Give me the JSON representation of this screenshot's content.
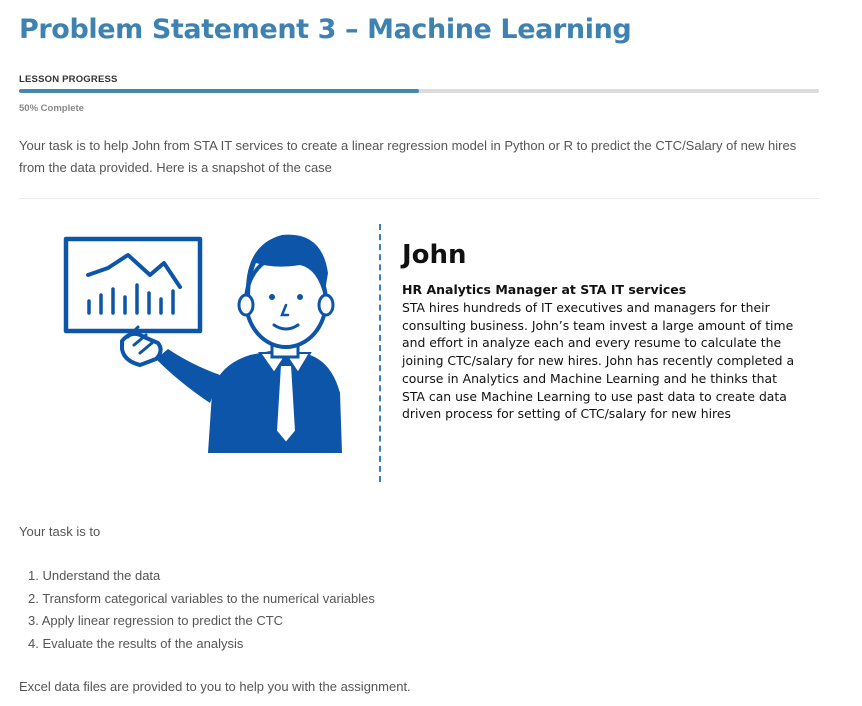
{
  "page": {
    "title": "Problem Statement 3 – Machine Learning"
  },
  "lesson_progress": {
    "label": "LESSON PROGRESS",
    "percent": 50,
    "status_text": "50% Complete"
  },
  "intro": {
    "text": "Your task is to help John from STA IT services to create a linear regression model in Python or R to predict the CTC/Salary of new hires from the data provided. Here is a snapshot of the case"
  },
  "case_card": {
    "illustration_icon": "presenter-with-chart-icon",
    "accent_color": "#0d55a8",
    "name": "John",
    "role": "HR Analytics Manager at STA IT services",
    "description": "STA hires hundreds of IT executives and managers for their consulting business. John’s team invest a large amount of time and effort in analyze each and every resume to calculate the joining CTC/salary for new hires. John has recently completed a course in Analytics and Machine Learning and he thinks that STA can use Machine Learning to use past data to create data driven process for setting of CTC/salary for new hires"
  },
  "tasks": {
    "intro": "Your task is to",
    "items": [
      "1. Understand the data",
      "2. Transform categorical variables to the numerical variables",
      "3. Apply linear regression to predict the CTC",
      "4. Evaluate the results of the analysis"
    ]
  },
  "footer": {
    "note": "Excel data files are provided to you to help you with the assignment."
  },
  "colors": {
    "title": "#3d82b0",
    "progress_fill": "#4a87b0",
    "progress_track": "#dcdcdc",
    "divider": "#3d7cc0"
  }
}
